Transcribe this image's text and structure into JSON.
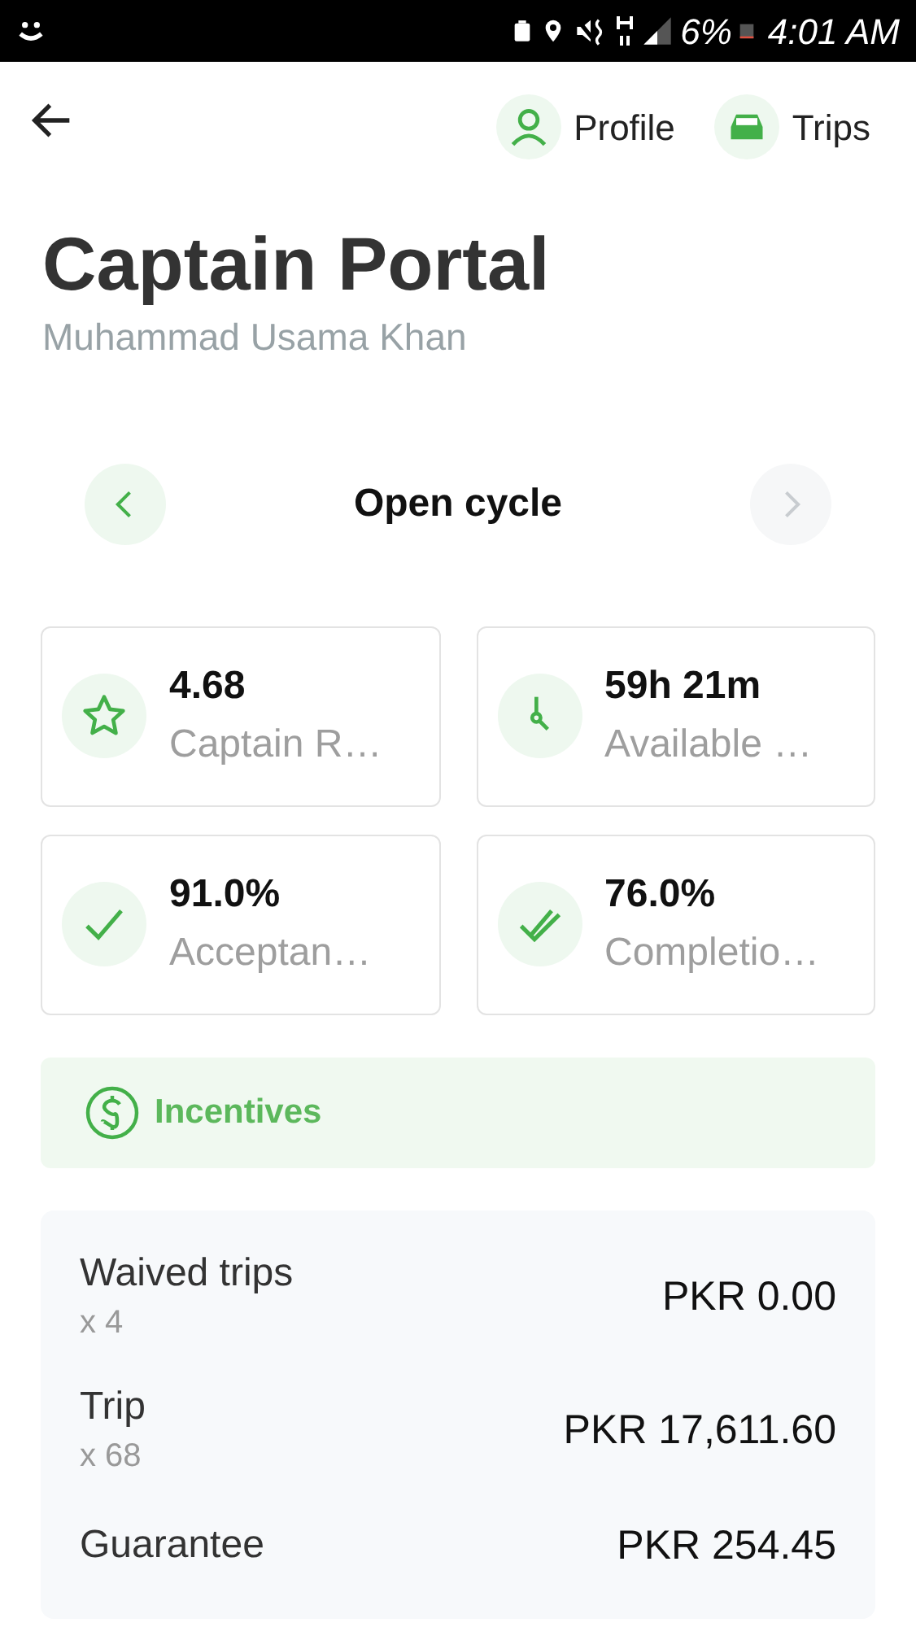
{
  "status_bar": {
    "battery": "6%",
    "time": "4:01 AM"
  },
  "header": {
    "links": [
      {
        "kind": "profile",
        "label": "Profile"
      },
      {
        "kind": "trips",
        "label": "Trips"
      }
    ]
  },
  "title": "Captain Portal",
  "subtitle": "Muhammad Usama Khan",
  "cycle": {
    "label": "Open cycle",
    "prev_disabled": false,
    "next_disabled": true
  },
  "stats": [
    {
      "kind": "star",
      "value": "4.68",
      "label": "Captain R…"
    },
    {
      "kind": "clock",
      "value": "59h 21m",
      "label": "Available …"
    },
    {
      "kind": "check",
      "value": "91.0%",
      "label": "Acceptan…"
    },
    {
      "kind": "double-check",
      "value": "76.0%",
      "label": "Completio…"
    }
  ],
  "incentives": {
    "title": "Incentives",
    "rows": [
      {
        "label": "Waived trips",
        "count": "x 4",
        "amount": "PKR 0.00"
      },
      {
        "label": "Trip",
        "count": "x 68",
        "amount": "PKR 17,611.60"
      },
      {
        "label": "Guarantee",
        "amount": "PKR 254.45"
      }
    ]
  }
}
